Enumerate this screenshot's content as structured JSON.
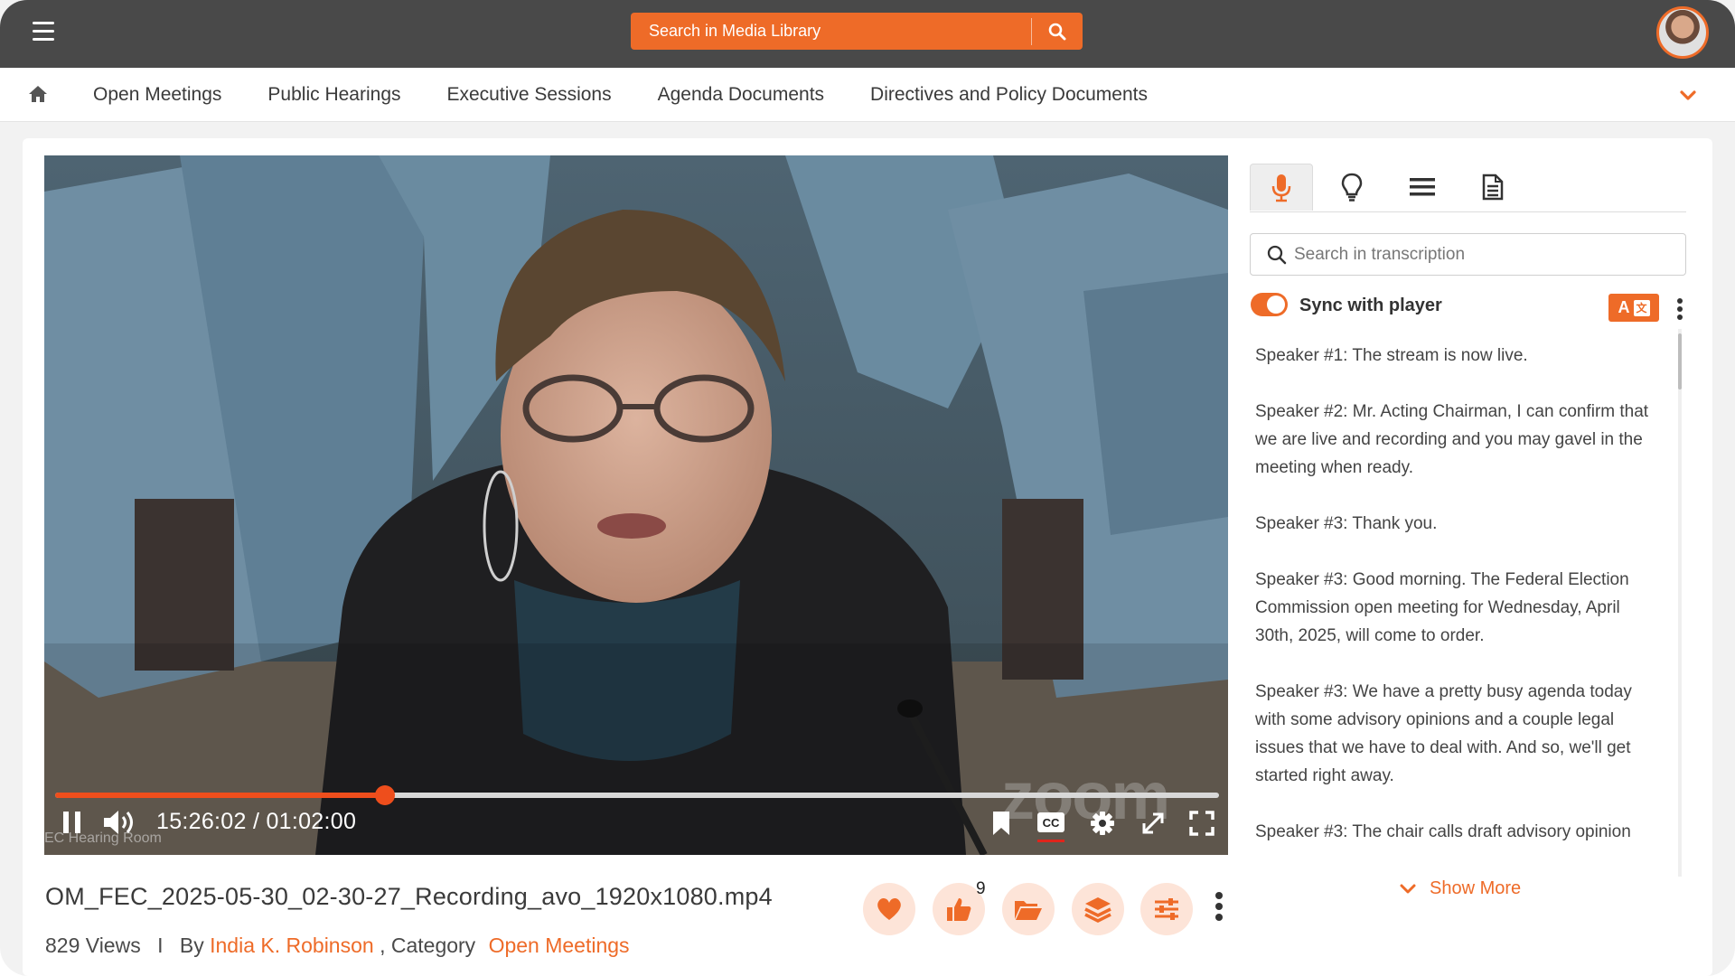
{
  "topbar": {
    "search_placeholder": "Search in Media Library",
    "menu_icon": "hamburger-menu-icon",
    "search_icon": "search-icon",
    "avatar_icon": "user-avatar"
  },
  "nav": {
    "home_icon": "home-icon",
    "items": [
      {
        "label": "Open Meetings"
      },
      {
        "label": "Public Hearings"
      },
      {
        "label": "Executive Sessions"
      },
      {
        "label": "Agenda Documents"
      },
      {
        "label": "Directives and Policy Documents"
      }
    ],
    "more_icon": "chevron-down-icon"
  },
  "player": {
    "time": "15:26:02 / 01:02:00",
    "progress_fraction": 0.283,
    "watermark_room": "EC Hearing Room",
    "watermark_brand": "zoom",
    "controls": [
      "pause-icon",
      "volume-icon",
      "bookmark-icon",
      "cc-icon",
      "settings-gear-icon",
      "expand-icon",
      "fullscreen-icon"
    ]
  },
  "media": {
    "title": "OM_FEC_2025-05-30_02-30-27_Recording_avo_1920x1080.mp4",
    "views": "829 Views",
    "separator": "I",
    "by_label": "By",
    "author": "India K. Robinson",
    "category_label": ", Category",
    "category": "Open Meetings",
    "like_count": "9",
    "actions": [
      "heart-icon",
      "thumbs-up-icon",
      "folder-open-icon",
      "layers-icon",
      "sliders-icon",
      "more-vertical-icon"
    ]
  },
  "panel": {
    "tabs": [
      "microphone-icon",
      "lightbulb-icon",
      "list-icon",
      "document-icon"
    ],
    "active_tab": 0,
    "search_placeholder": "Search in transcription",
    "sync_label": "Sync with player",
    "sync_on": true,
    "translate_label_a": "A",
    "translate_label_b": "文",
    "transcript": [
      "Speaker #1: The stream is now live.",
      "Speaker #2: Mr. Acting Chairman, I can confirm that we are live and recording and you may gavel in the meeting when ready.",
      "Speaker #3: Thank you.",
      "Speaker #3: Good morning. The Federal Election Commission open meeting for Wednesday, April 30th, 2025, will come to order.",
      "Speaker #3: We have a pretty busy agenda today with some advisory opinions and a couple legal issues that we have to deal with. And so, we'll get started right away.",
      "Speaker #3: The chair calls draft advisory opinion"
    ],
    "show_more": "Show More"
  },
  "colors": {
    "accent": "#ee6b28",
    "topbar": "#494949",
    "progress": "#ee4e1c"
  }
}
